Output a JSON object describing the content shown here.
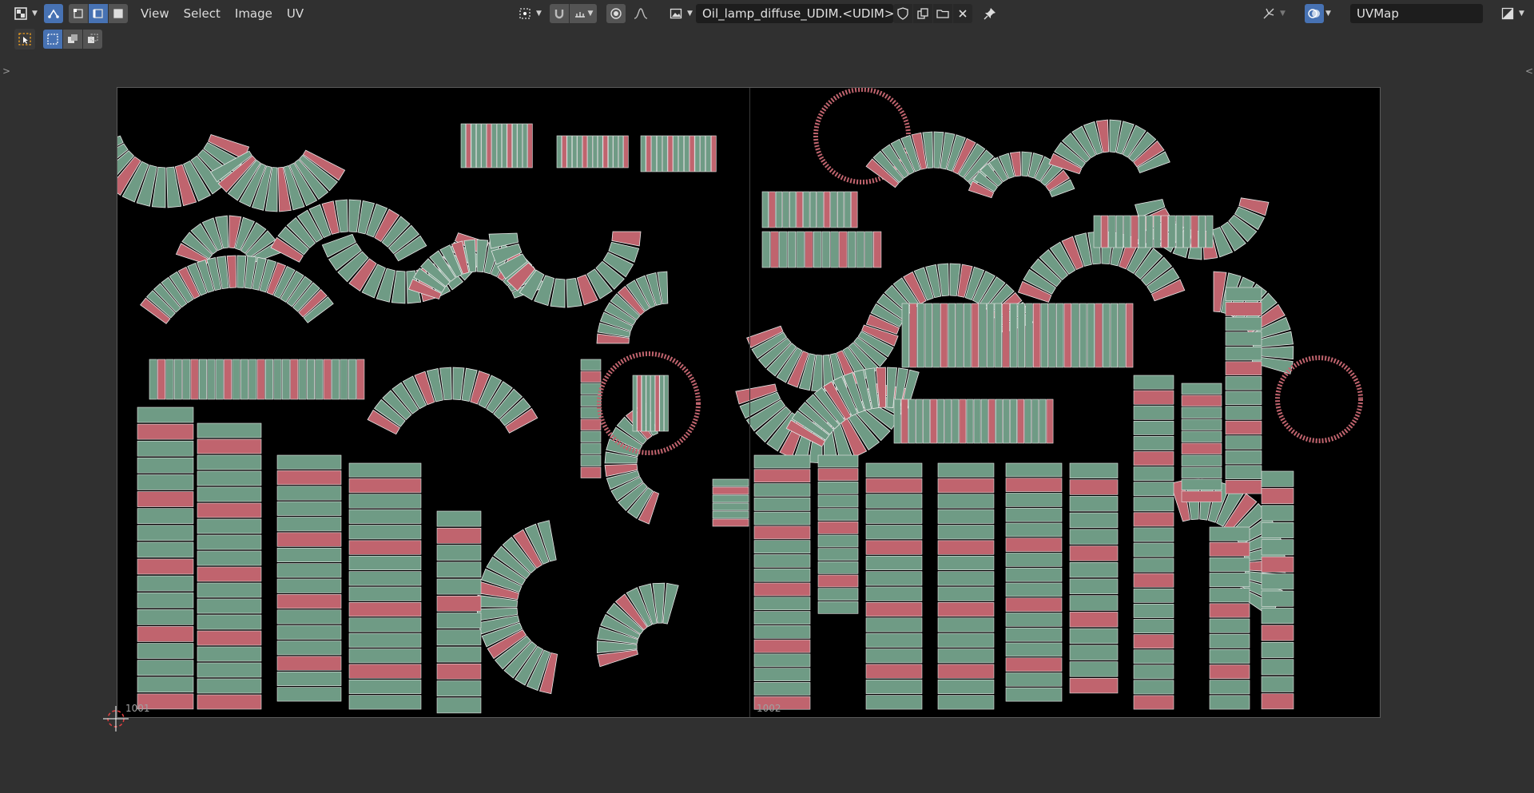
{
  "header": {
    "editor_type_icon": "uv-editor-icon",
    "sync_icon": "uv-sync-selection-icon",
    "select_mode_icons": [
      "vertex-select-icon",
      "edge-select-icon",
      "face-select-icon"
    ],
    "menus": [
      "View",
      "Select",
      "Image",
      "UV"
    ],
    "pivot_icon": "pivot-point-icon",
    "snap_icon": "snap-magnet-icon",
    "snap_target_icon": "snap-increment-icon",
    "proportional_icon": "proportional-edit-icon",
    "falloff_icon": "falloff-curve-icon",
    "image_browse_icon": "image-browse-icon",
    "image_name": "Oil_lamp_diffuse_UDIM.<UDIM>.png",
    "image_actions": [
      "fake-user-shield-icon",
      "duplicate-image-icon",
      "open-folder-icon",
      "unlink-close-icon"
    ],
    "pin_icon": "pin-icon",
    "gizmo_icon": "gizmo-icon",
    "overlay_icon": "overlay-icon",
    "uv_map": "UVMap",
    "display_channels_icon": "display-channels-icon"
  },
  "toolbar": {
    "select_tool_icon": "select-box-tool-icon",
    "mode_icons": [
      "select-new-icon",
      "select-extend-icon",
      "select-subtract-icon"
    ]
  },
  "udim_tiles": [
    {
      "label": "1001"
    },
    {
      "label": "1002"
    }
  ],
  "colors": {
    "background": "#303030",
    "accent_active": "#4772b3",
    "uv_island_green": "#6f9b85",
    "uv_island_red": "#c0646e",
    "uv_edge_white": "#e8e8e8"
  }
}
